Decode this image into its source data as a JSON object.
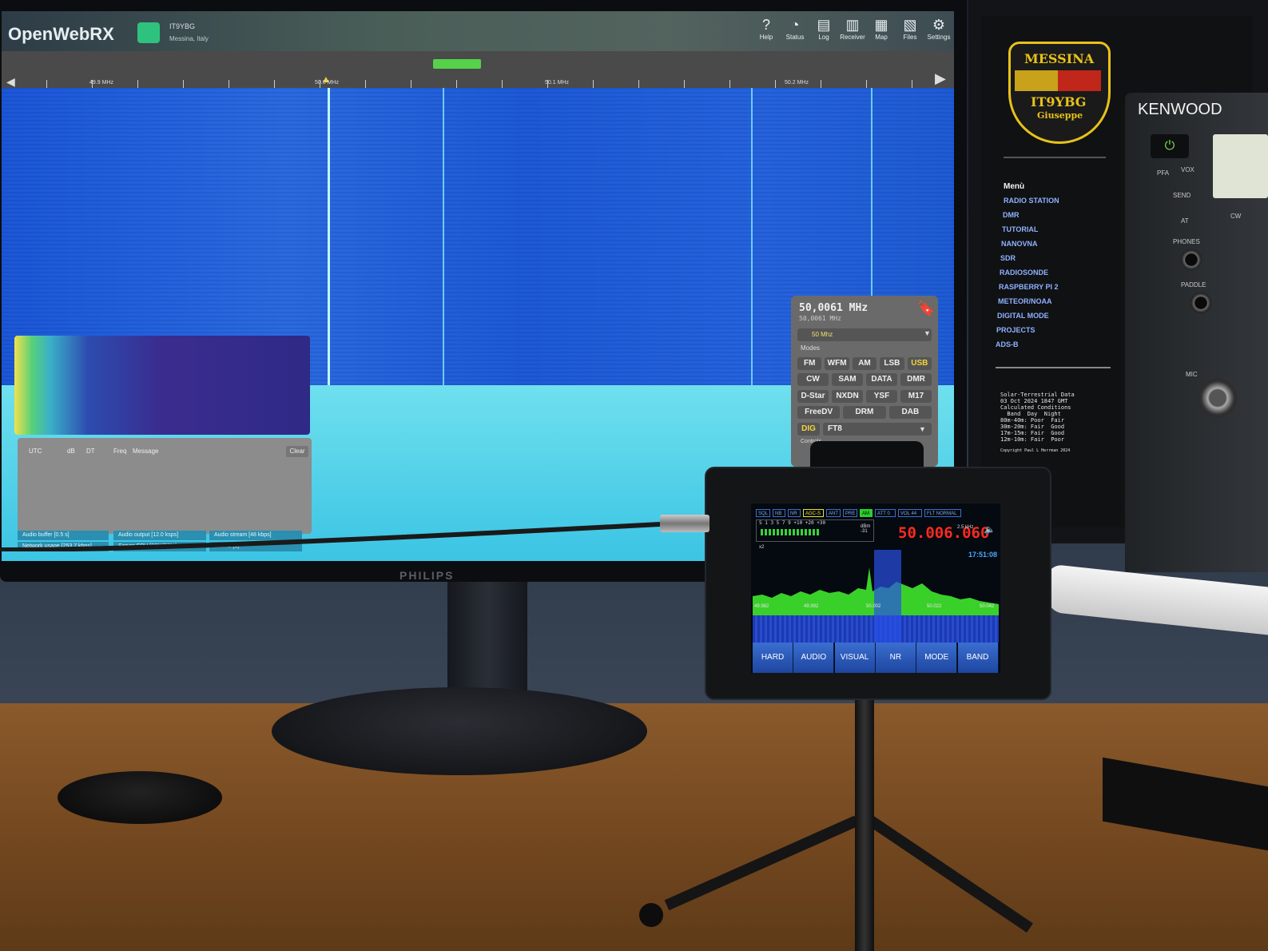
{
  "openwebrx": {
    "logo": "OpenWebRX",
    "receiver_name": "IT9YBG",
    "receiver_location": "Messina, Italy",
    "nav": [
      {
        "label": "Help",
        "icon": "help-icon"
      },
      {
        "label": "Status",
        "icon": "status-icon"
      },
      {
        "label": "Log",
        "icon": "log-icon"
      },
      {
        "label": "Receiver",
        "icon": "receiver-icon"
      },
      {
        "label": "Map",
        "icon": "map-icon"
      },
      {
        "label": "Files",
        "icon": "files-icon"
      },
      {
        "label": "Settings",
        "icon": "settings-icon"
      }
    ],
    "scale_labels": [
      "49.9 MHz",
      "50.0 MHz",
      "50.1 MHz",
      "50.2 MHz"
    ],
    "ft8_columns": [
      "UTC",
      "dB",
      "DT",
      "Freq",
      "Message"
    ],
    "ft8_clear": "Clear",
    "status_bars": [
      "Audio buffer [0.5 s]",
      "Audio output [12.0 ksps]",
      "Audio stream [48 kbps]",
      "Network usage [253.7 kbps]",
      "Server CPU [32%|52%]",
      "Clients [1]"
    ]
  },
  "receiver_panel": {
    "frequency": "50,0061 MHz",
    "frequency_small": "50,0061 MHz",
    "band": "50 Mhz",
    "modes_label": "Modes",
    "controls_label": "Controls",
    "modes_row1": [
      "FM",
      "WFM",
      "AM",
      "LSB",
      "USB"
    ],
    "modes_row2": [
      "CW",
      "SAM",
      "DATA",
      "DMR"
    ],
    "modes_row3": [
      "D-Star",
      "NXDN",
      "YSF",
      "M17"
    ],
    "modes_row4": [
      "FreeDV",
      "DRM",
      "DAB"
    ],
    "digital_mode_label": "DIG",
    "digital_mode": "FT8",
    "active_mode": "USB"
  },
  "monitor": {
    "brand": "PHILIPS"
  },
  "website": {
    "badge_city": "MESSINA",
    "badge_callsign": "IT9YBG",
    "badge_name": "Giuseppe",
    "menu_title": "Menù",
    "menu_items": [
      "RADIO STATION",
      "DMR",
      "TUTORIAL",
      "NANOVNA",
      "SDR",
      "RADIOSONDE",
      "RASPBERRY PI 2",
      "METEOR/NOAA",
      "DIGITAL MODE",
      "PROJECTS",
      "ADS-B"
    ],
    "solar_lines": [
      "Solar-Terrestrial Data",
      "03 Oct 2024 1847 GMT",
      "Calculated Conditions",
      "  Band  Day  Night",
      "80m-40m: Poor  Fair",
      "30m-20m: Fair  Good",
      "17m-15m: Fair  Good",
      "12m-10m: Fair  Poor"
    ],
    "solar_copyright": "Copyright Paul L Herrman 2024"
  },
  "kenwood": {
    "brand": "KENWOOD",
    "labels": [
      "PFA",
      "VOX",
      "SEND",
      "AT",
      "PHONES",
      "PADDLE",
      "MIC",
      "CW"
    ]
  },
  "portable_sdr": {
    "tabs": [
      "SQL",
      "NB",
      "NR",
      "AGC-S",
      "ANT",
      "PRE",
      "AM",
      "ATT 0",
      "VOL 44",
      "FLT NORMAL"
    ],
    "highlight_tab": "AGC-S",
    "active_tab": "AM",
    "smeter_scale": "S  1  3  5  7  9  +10 +20 +30",
    "dbm_label": "dBm",
    "dbm_value": "-31",
    "frequency": "50.006.060",
    "bandwidth": "2.5 kHz",
    "clock": "17:51:08",
    "zoom": "x2",
    "axis_labels": [
      "49.982",
      "49.992",
      "50.002",
      "50.022",
      "50.042"
    ],
    "buttons": [
      "HARD",
      "AUDIO",
      "VISUAL",
      "NR",
      "MODE",
      "BAND"
    ]
  },
  "colors": {
    "owrx_accent": "#55d24a",
    "waterfall_blue": "#1e5bd4",
    "sdr_freq_red": "#ff2a1e",
    "badge_gold": "#e8c21a",
    "menu_link": "#8fb2ff"
  }
}
